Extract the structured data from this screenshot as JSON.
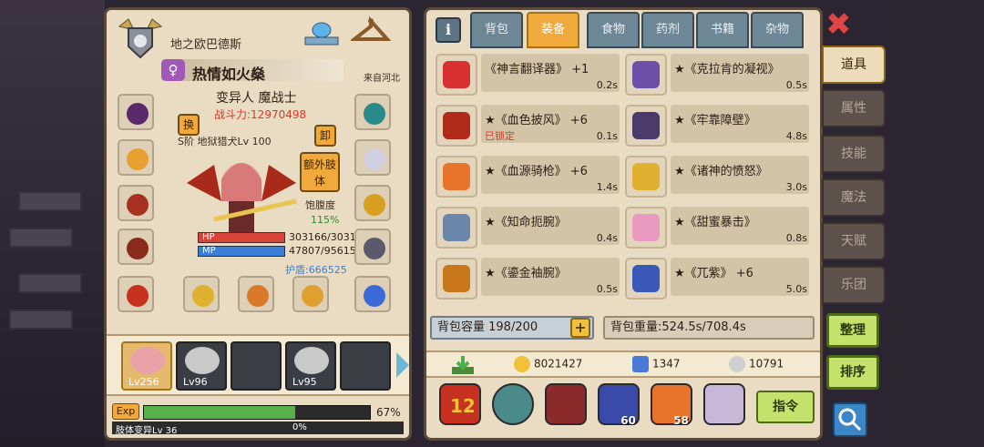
{
  "character": {
    "name": "地之欧巴德斯",
    "title": "热情如火燊",
    "title_badge": "♀",
    "origin": "来自河北",
    "race_class": "变异人 魔战士",
    "power": "战斗力:12970498",
    "swap_label": "换",
    "unequip_label": "卸",
    "extra_limb_label": "额外肢体",
    "skill_line": "S阶 地狱猎犬Lv 100",
    "satiety_label": "饱腹度",
    "satiety_value": "115%",
    "hp_label": "HP",
    "hp_value": "303166/3031",
    "mp_label": "MP",
    "mp_value": "47807/95615",
    "shield": "护盾:666525",
    "hp_fraction": 1.0,
    "mp_fraction": 0.5
  },
  "party": [
    {
      "level": "Lv256",
      "active": true,
      "color": "#e9a3a8"
    },
    {
      "level": "Lv96",
      "active": false,
      "color": "#c9c9c9"
    },
    {
      "level": "",
      "active": false,
      "color": ""
    },
    {
      "level": "Lv95",
      "active": false,
      "color": "#c9c9c9"
    },
    {
      "level": "",
      "active": false,
      "color": ""
    }
  ],
  "exp": {
    "label": "Exp",
    "percent_text": "67%",
    "fraction": 0.67,
    "mutation_label": "肢体变异Lv 36",
    "mutation_percent": "0%"
  },
  "inventory": {
    "tabs": [
      "背包",
      "装备",
      "食物",
      "药剂",
      "书籍",
      "杂物"
    ],
    "active_tab": 1,
    "info_label": "i",
    "items": [
      {
        "name": "《神言翻译器》 +1",
        "weight": "0.2s",
        "locked": "",
        "color": "#d83030"
      },
      {
        "name": "★《克拉肯的凝视》",
        "weight": "0.5s",
        "locked": "",
        "color": "#6b4fa8"
      },
      {
        "name": "★《血色披风》 +6",
        "weight": "0.1s",
        "locked": "已锁定",
        "color": "#b02a1a"
      },
      {
        "name": "★《牢靠障壁》",
        "weight": "4.8s",
        "locked": "",
        "color": "#4a3a6a"
      },
      {
        "name": "★《血源骑枪》 +6",
        "weight": "1.4s",
        "locked": "",
        "color": "#e8732a"
      },
      {
        "name": "★《诸神的愤怒》",
        "weight": "3.0s",
        "locked": "",
        "color": "#e0b030"
      },
      {
        "name": "★《知命扼腕》",
        "weight": "0.4s",
        "locked": "",
        "color": "#6a86a8"
      },
      {
        "name": "★《甜蜜暴击》",
        "weight": "0.8s",
        "locked": "",
        "color": "#e89ac0"
      },
      {
        "name": "★《鎏金袖腕》",
        "weight": "0.5s",
        "locked": "",
        "color": "#c8781a"
      },
      {
        "name": "★《兀紫》 +6",
        "weight": "5.0s",
        "locked": "",
        "color": "#3a58b8"
      }
    ],
    "capacity": "背包容量 198/200",
    "weight": "背包重量:524.5s/708.4s",
    "gold": "8021427",
    "diamonds": "1347",
    "silver": "10791",
    "potion_count": "60",
    "guitar_count": "58",
    "command_label": "指令"
  },
  "side_tabs": [
    "道具",
    "属性",
    "技能",
    "魔法",
    "天赋",
    "乐团"
  ],
  "side_active": 0,
  "side_buttons": {
    "organize": "整理",
    "sort": "排序"
  },
  "colors": {
    "panel": "#e9dcc3",
    "accent_orange": "#f0a93a",
    "tab_blue": "#6e8797",
    "green_button": "#c5e26c"
  }
}
